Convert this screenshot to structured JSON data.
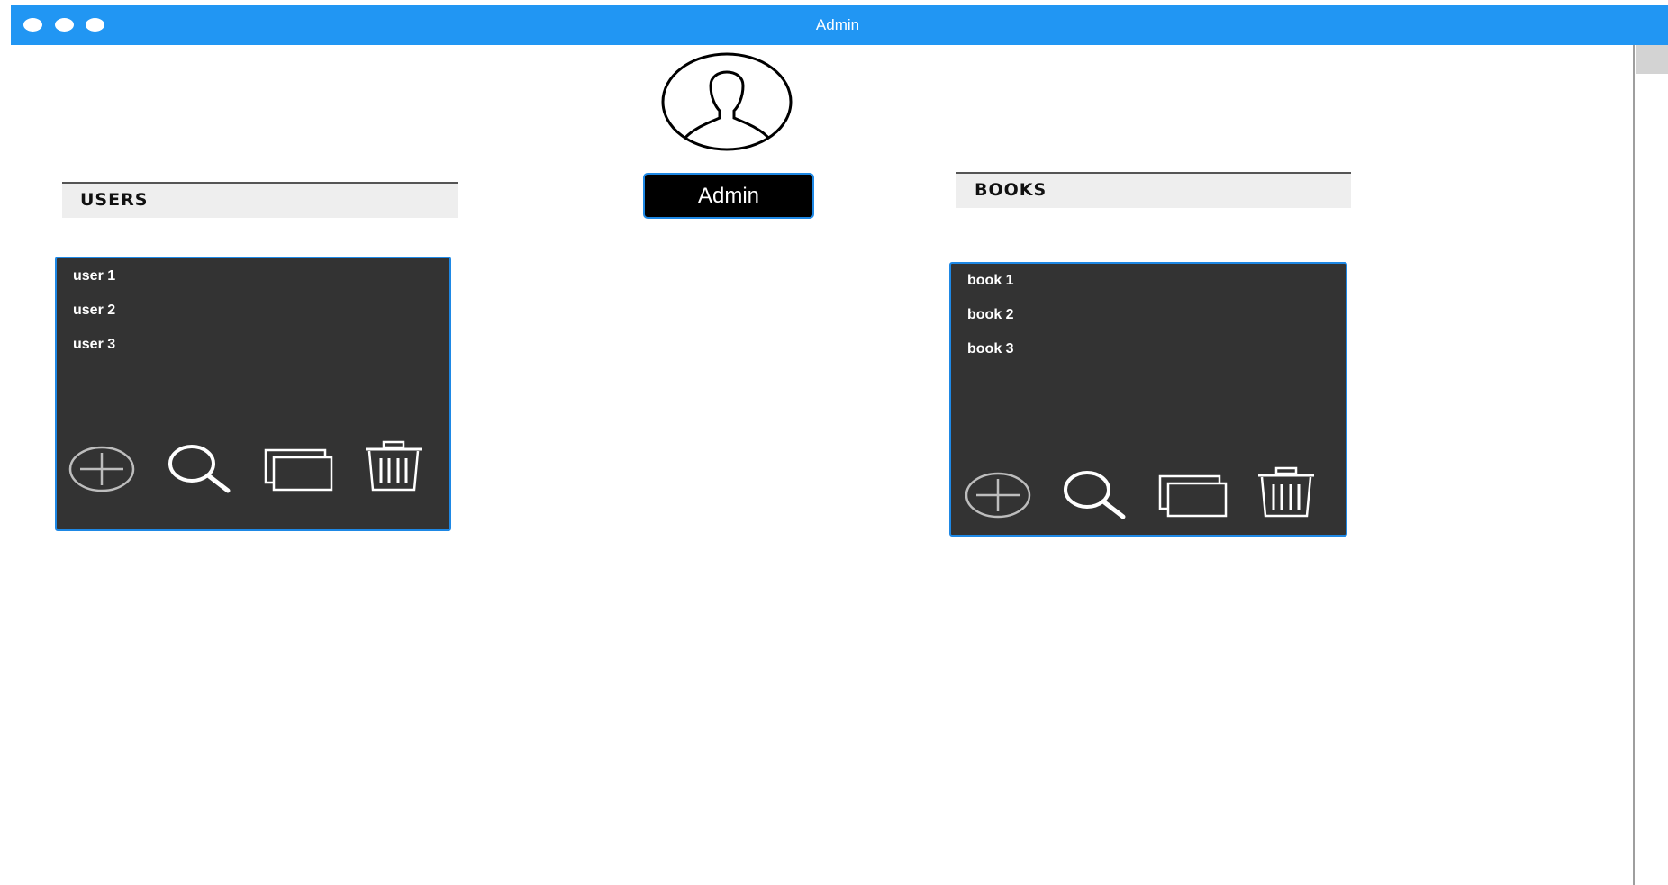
{
  "window": {
    "title": "Admin"
  },
  "admin_button": {
    "label": "Admin"
  },
  "users": {
    "header": "USERS",
    "items": [
      {
        "label": "user 1"
      },
      {
        "label": "user 2"
      },
      {
        "label": "user 3"
      }
    ],
    "actions": [
      "add-icon",
      "search-icon",
      "copy-icon",
      "trash-icon"
    ]
  },
  "books": {
    "header": "BOOKS",
    "items": [
      {
        "label": "book 1"
      },
      {
        "label": "book 2"
      },
      {
        "label": "book 3"
      }
    ],
    "actions": [
      "add-icon",
      "search-icon",
      "copy-icon",
      "trash-icon"
    ]
  },
  "colors": {
    "titlebar": "#2196f3",
    "panel_bg": "#333333",
    "panel_border": "#1e88e5",
    "header_bg": "#eeeeee",
    "button_bg": "#000000"
  }
}
